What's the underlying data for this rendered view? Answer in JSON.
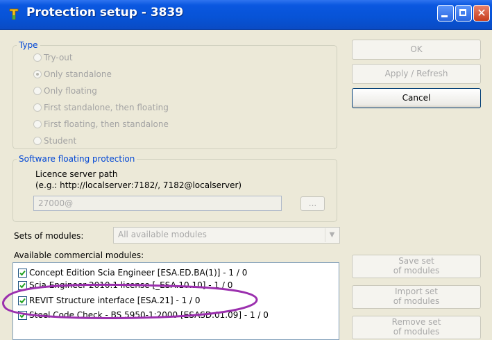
{
  "window": {
    "title": "Protection setup - 3839",
    "minimize_label": "",
    "maximize_label": "",
    "close_label": "✕"
  },
  "type_group": {
    "legend": "Type",
    "options": [
      {
        "label": "Try-out",
        "checked": false
      },
      {
        "label": "Only standalone",
        "checked": true
      },
      {
        "label": "Only floating",
        "checked": false
      },
      {
        "label": "First standalone, then floating",
        "checked": false
      },
      {
        "label": "First floating, then standalone",
        "checked": false
      },
      {
        "label": "Student",
        "checked": false
      }
    ]
  },
  "floating_group": {
    "legend": "Software floating protection",
    "path_label": "Licence server path",
    "path_example": "(e.g.: http://localserver:7182/, 7182@localserver)",
    "path_value": "27000@",
    "browse_label": "..."
  },
  "sets": {
    "label": "Sets of modules:",
    "selected": "All available modules"
  },
  "modules": {
    "label": "Available commercial modules:",
    "items": [
      {
        "label": "Concept Edition Scia Engineer [ESA.ED.BA(1)] - 1 / 0",
        "checked": true
      },
      {
        "label": "Scia Engineer 2010.1 license [_ESA.10.10] - 1 / 0",
        "checked": true
      },
      {
        "label": "REVIT Structure interface [ESA.21] - 1 / 0",
        "checked": true
      },
      {
        "label": "Steel Code Check - BS 5950-1:2000 [ESASD.01.09] - 1 / 0",
        "checked": true
      }
    ]
  },
  "buttons": {
    "ok": "OK",
    "apply": "Apply / Refresh",
    "cancel": "Cancel",
    "save_set": [
      "Save set",
      "of modules"
    ],
    "import_set": [
      "Import set",
      "of modules"
    ],
    "remove_set": [
      "Remove set",
      "of modules"
    ]
  },
  "colors": {
    "titlebar": "#0753d6",
    "legend": "#0046d5",
    "annotation": "#9b2fae"
  }
}
